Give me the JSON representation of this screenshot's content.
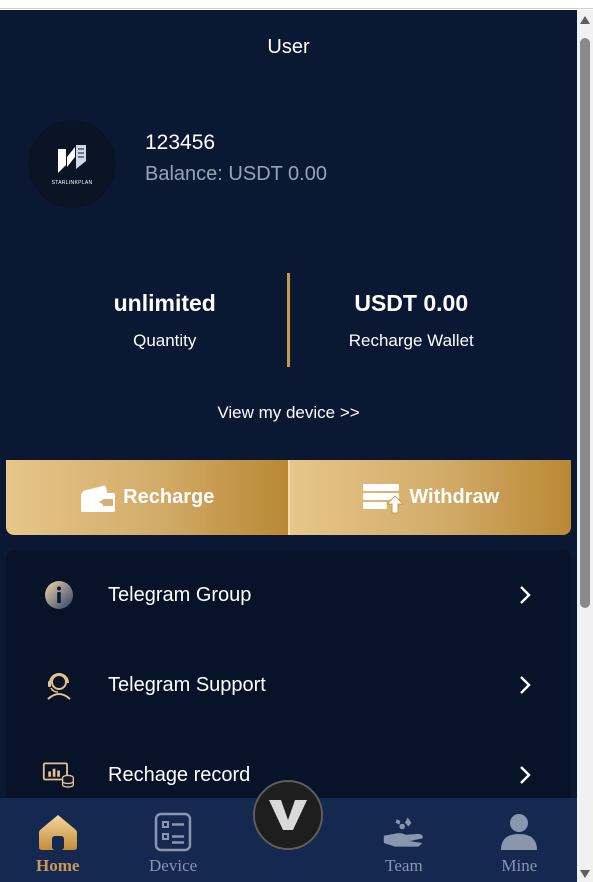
{
  "header": {
    "title": "User"
  },
  "profile": {
    "avatar_text": "STARLINKPLAN",
    "username": "123456",
    "balance_label": "Balance:",
    "balance_value": "USDT 0.00"
  },
  "stats": [
    {
      "value": "unlimited",
      "label": "Quantity"
    },
    {
      "value": "USDT 0.00",
      "label": "Recharge Wallet"
    }
  ],
  "view_device": "View my device >>",
  "actions": {
    "recharge": "Recharge",
    "withdraw": "Withdraw"
  },
  "menu": [
    {
      "label": "Telegram Group",
      "icon": "info-icon"
    },
    {
      "label": "Telegram Support",
      "icon": "support-agent-icon"
    },
    {
      "label": "Rechage record",
      "icon": "chart-records-icon"
    }
  ],
  "tabbar": {
    "home": "Home",
    "device": "Device",
    "team": "Team",
    "mine": "Mine"
  },
  "colors": {
    "background": "#0b1833",
    "accent_gold": "#c9995a",
    "tabbar": "#152850"
  }
}
